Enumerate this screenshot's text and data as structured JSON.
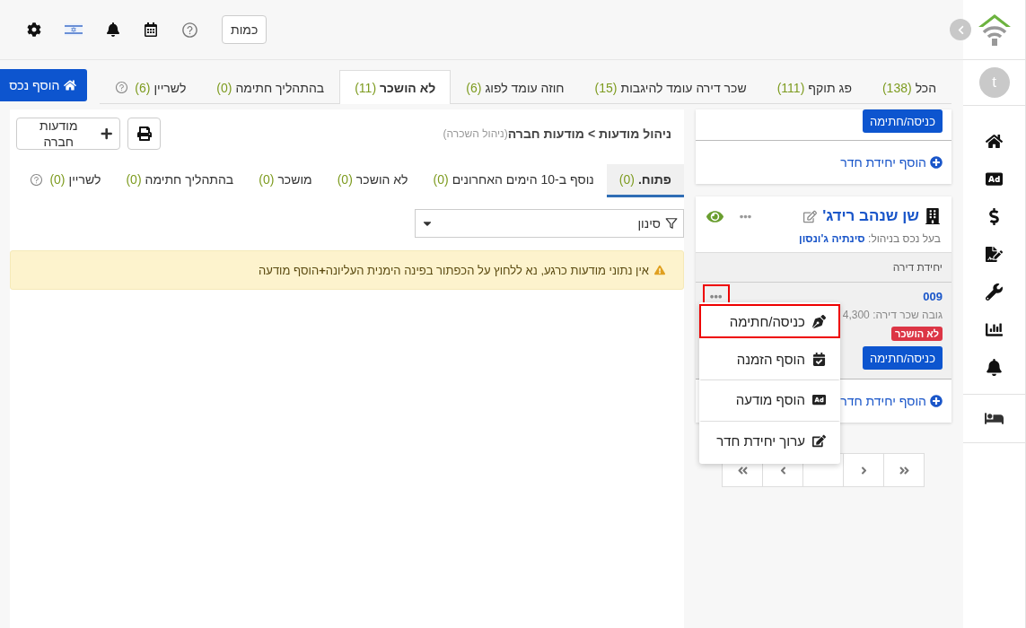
{
  "header": {
    "quantity_button": "כמות"
  },
  "user": {
    "avatar": "t"
  },
  "tabs": [
    {
      "label": "הכל",
      "count": "(138)",
      "selected": false
    },
    {
      "label": "פג תוקף",
      "count": "(111)",
      "selected": false
    },
    {
      "label": "שכר דירה עומד להיגבות",
      "count": "(15)",
      "selected": false
    },
    {
      "label": "חוזה עומד לפוג",
      "count": "(6)",
      "selected": false
    },
    {
      "label": "לא הושכר",
      "count": "(11)",
      "selected": true
    },
    {
      "label": "בהתהליך חתימה",
      "count": "(0)",
      "selected": false
    },
    {
      "label": "לשריין",
      "count": "(6)",
      "selected": false
    }
  ],
  "add_property_button": "הוסף נכס",
  "breadcrumb": {
    "path": "ניהול מודעות > מודעות חברה",
    "note": "(ניהול השכרה)"
  },
  "company_ads_button": "מודעות חברה",
  "sub_tabs": [
    {
      "label": "פתוח.",
      "count": "(0)",
      "selected": true
    },
    {
      "label": "נוסף ב-10 הימים האחרונים",
      "count": "(0)",
      "selected": false
    },
    {
      "label": "לא הושכר",
      "count": "(0)",
      "selected": false
    },
    {
      "label": "מושכר",
      "count": "(0)",
      "selected": false
    },
    {
      "label": "בהתהליך חתימה",
      "count": "(0)",
      "selected": false
    },
    {
      "label": "לשריין",
      "count": "(0)",
      "selected": false
    }
  ],
  "filter": {
    "placeholder": "סינון"
  },
  "alert": "אין נתוני מודעות כרגע, נא ללחוץ על הכפתור בפינה הימנית העליונה**+**הוסף מודעה",
  "partial_card": {
    "action_button": "כניסה/חתימה",
    "add_unit_link": "הוסף יחידת חדר"
  },
  "property": {
    "name": "שן שנהב רידג'",
    "owner_label": "בעל נכס בניהול:",
    "owner": "סינתיה ג'ונסון",
    "section": "יחידת דירה",
    "unit": {
      "number": "009",
      "rent_label": "גובה שכר דירה:",
      "rent": "4,300",
      "status": "לא הושכר",
      "action_button": "כניסה/חתימה",
      "menu_button_highlighted": true
    },
    "add_unit_link": "הוסף יחידת חדר"
  },
  "menu": [
    {
      "label": "כניסה/חתימה",
      "kind": "sign",
      "highlighted": true
    },
    {
      "label": "הוסף הזמנה",
      "kind": "booking",
      "highlighted": false
    },
    {
      "label": "הוסף מודעה",
      "kind": "ad",
      "highlighted": false
    },
    {
      "label": "ערוך יחידת חדר",
      "kind": "edit",
      "highlighted": false
    }
  ]
}
